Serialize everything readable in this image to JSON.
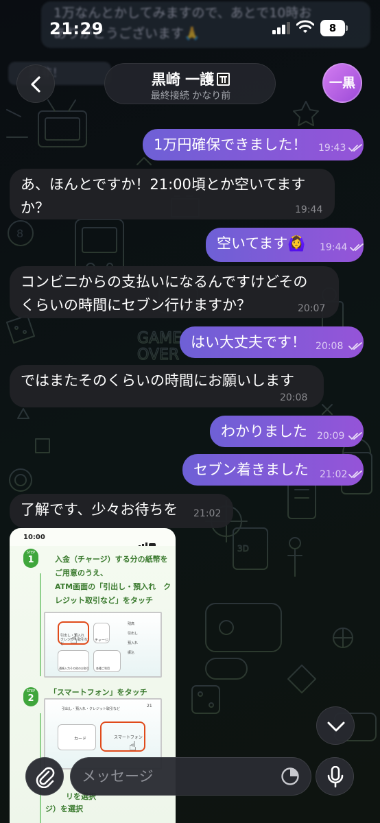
{
  "status_bar": {
    "time": "21:29",
    "battery_level": "8"
  },
  "blurred_notification": {
    "line1": "1万なんとかしてみますので、あとで10時お",
    "line2": "ありがとうございます🙏",
    "strip": "是非！"
  },
  "header": {
    "title": "黒崎 一護",
    "last_seen": "最終接続 かなり前",
    "avatar_initials": "一黒"
  },
  "messages": [
    {
      "direction": "outgoing",
      "lines": [
        "1万円確保できました！"
      ],
      "time": "19:43",
      "read": true
    },
    {
      "direction": "incoming",
      "lines": [
        "あ、ほんとですか！21:00頃とか空いてます",
        "か？"
      ],
      "time": "19:44"
    },
    {
      "direction": "outgoing",
      "lines": [
        "空いてます🙆‍♀️"
      ],
      "time": "19:44",
      "read": true
    },
    {
      "direction": "incoming",
      "lines": [
        "コンビニからの支払いになるんですけどその",
        "くらいの時間にセブン行けますか？"
      ],
      "time": "20:07"
    },
    {
      "direction": "outgoing",
      "lines": [
        "はい大丈夫です！"
      ],
      "time": "20:08",
      "read": true
    },
    {
      "direction": "incoming",
      "lines": [
        "ではまたそのくらいの時間にお願いします"
      ],
      "time": "20:08"
    },
    {
      "direction": "outgoing",
      "lines": [
        "わかりました"
      ],
      "time": "20:09",
      "read": true
    },
    {
      "direction": "outgoing",
      "lines": [
        "セブン着きました"
      ],
      "time": "21:02",
      "read": true
    },
    {
      "direction": "incoming",
      "lines": [
        "了解です、少々お待ちを"
      ],
      "time": "21:02"
    }
  ],
  "image_message": {
    "status_time": "10:00",
    "step_word": "STEP",
    "steps": [
      {
        "number": "1",
        "lines": [
          "入金（チャージ）する分の紙幣を",
          "ご用意のうえ、",
          "ATM画面の「引出し・預入れ　ク",
          "レジット取引など」をタッチ"
        ]
      },
      {
        "number": "2",
        "lines": [
          "「スマートフォン」をタッチ"
        ]
      },
      {
        "number": "3",
        "lines": [
          "リを選択",
          "ジ）を選択"
        ]
      }
    ],
    "atm1": {
      "highlight_label": "引出し・預入れ クレジット取引など",
      "charge_label": "チャージ",
      "deposit_label": "通帳入力その他のお取引",
      "other_label": "各種ご利用",
      "side_items": [
        "残高",
        "引出し",
        "預入れ",
        "振込"
      ]
    },
    "atm2": {
      "title": "引出し・預入れ・クレジット取引など",
      "card_label": "カード",
      "phone_label": "スマートフォン",
      "corner": "21"
    }
  },
  "composer": {
    "placeholder": "メッセージ"
  },
  "icons": {
    "back": "chevron-left-icon",
    "attach": "paperclip-icon",
    "sticker": "sticker-icon",
    "mic": "microphone-icon",
    "scroll": "chevron-down-icon"
  },
  "colors": {
    "outgoing_bubble_start": "#6e60d6",
    "outgoing_bubble_end": "#9554d8",
    "incoming_bubble": "#212226",
    "avatar": "#c26ce8",
    "step_green": "#3fa63c"
  }
}
